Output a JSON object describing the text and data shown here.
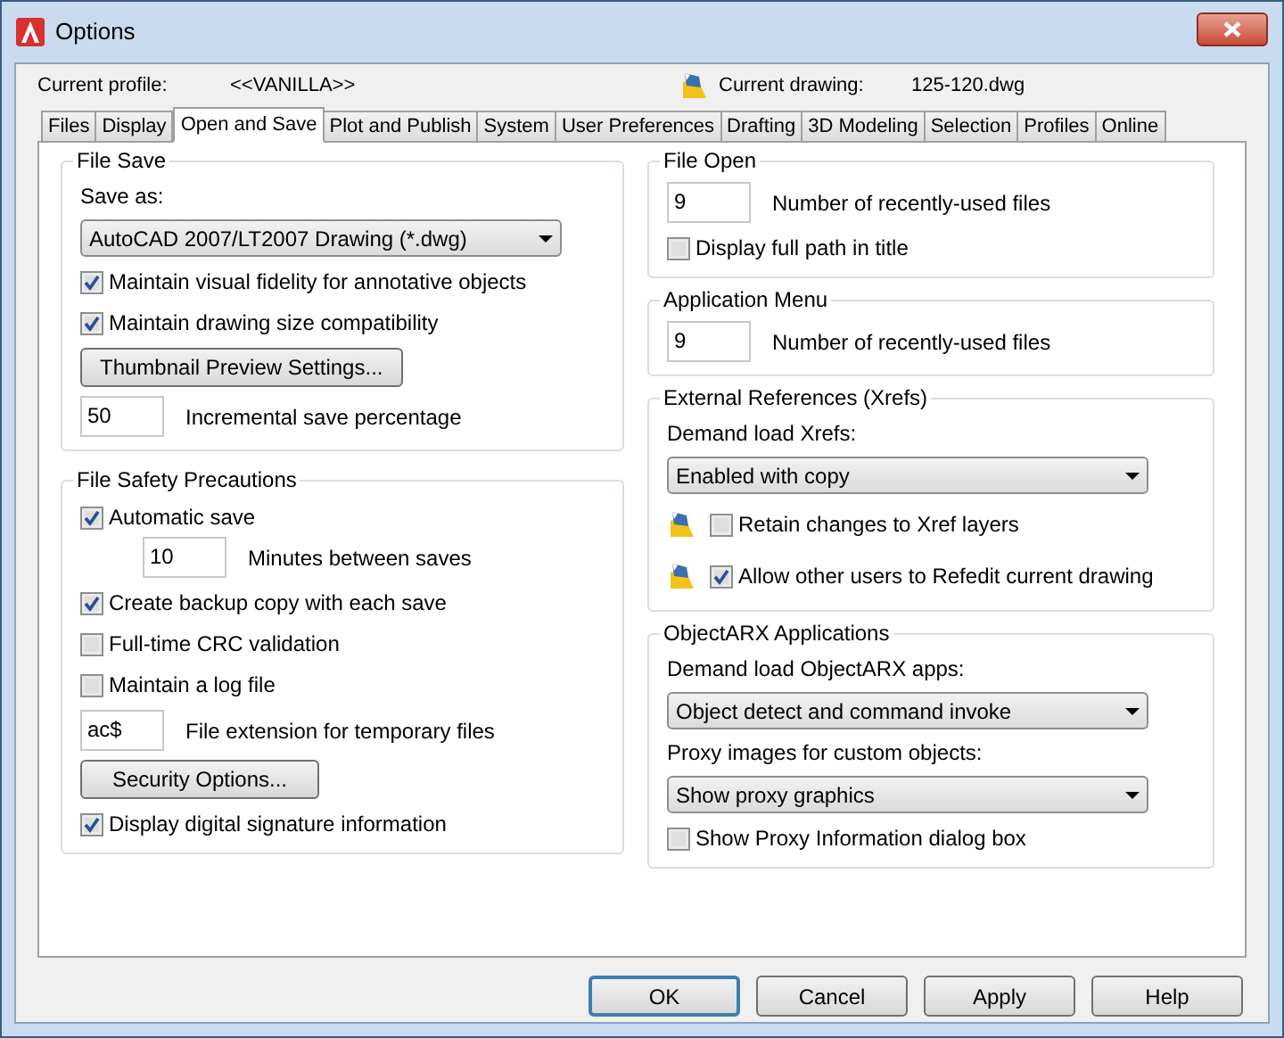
{
  "window": {
    "title": "Options"
  },
  "header": {
    "profile_label": "Current profile:",
    "profile": "<<VANILLA>>",
    "drawing_label": "Current drawing:",
    "drawing": "125-120.dwg"
  },
  "tabs": [
    {
      "label": "Files",
      "selected": false
    },
    {
      "label": "Display",
      "selected": false
    },
    {
      "label": "Open and Save",
      "selected": true
    },
    {
      "label": "Plot and Publish",
      "selected": false
    },
    {
      "label": "System",
      "selected": false
    },
    {
      "label": "User Preferences",
      "selected": false
    },
    {
      "label": "Drafting",
      "selected": false
    },
    {
      "label": "3D Modeling",
      "selected": false
    },
    {
      "label": "Selection",
      "selected": false
    },
    {
      "label": "Profiles",
      "selected": false
    },
    {
      "label": "Online",
      "selected": false
    }
  ],
  "columns": [
    [
      {
        "title": "File Save",
        "items": [
          {
            "kind": "label",
            "text": "Save as:"
          },
          {
            "kind": "dropdown",
            "value": "AutoCAD 2007/LT2007 Drawing (*.dwg)"
          },
          {
            "kind": "checkbox",
            "label": "Maintain visual fidelity for annotative objects",
            "checked": true
          },
          {
            "kind": "checkbox",
            "label": "Maintain drawing size compatibility",
            "checked": true
          },
          {
            "kind": "button",
            "label": "Thumbnail Preview Settings..."
          },
          {
            "kind": "number",
            "value": "50",
            "caption": "Incremental save percentage"
          }
        ]
      },
      {
        "title": "File Safety Precautions",
        "items": [
          {
            "kind": "checkbox",
            "label": "Automatic save",
            "checked": true,
            "children": [
              {
                "kind": "number",
                "value": "10",
                "caption": "Minutes between saves"
              }
            ]
          },
          {
            "kind": "checkbox",
            "label": "Create backup copy with each save",
            "checked": true
          },
          {
            "kind": "checkbox",
            "label": "Full-time CRC validation",
            "checked": false
          },
          {
            "kind": "checkbox",
            "label": "Maintain a log file",
            "checked": false
          },
          {
            "kind": "number",
            "value": "ac$",
            "caption": "File extension for temporary files"
          },
          {
            "kind": "button",
            "label": "Security Options..."
          },
          {
            "kind": "checkbox",
            "label": "Display digital signature information",
            "checked": true
          }
        ]
      }
    ],
    [
      {
        "title": "File Open",
        "items": [
          {
            "kind": "number",
            "value": "9",
            "caption": "Number of recently-used files"
          },
          {
            "kind": "checkbox",
            "label": "Display full path in title",
            "checked": false
          }
        ]
      },
      {
        "title": "Application Menu",
        "items": [
          {
            "kind": "number",
            "value": "9",
            "caption": "Number of recently-used files"
          }
        ]
      },
      {
        "title": "External References (Xrefs)",
        "items": [
          {
            "kind": "label",
            "text": "Demand load Xrefs:"
          },
          {
            "kind": "dropdown",
            "value": "Enabled with copy"
          },
          {
            "kind": "drawing_checkbox",
            "label": "Retain changes to Xref layers",
            "checked": false
          },
          {
            "kind": "drawing_checkbox",
            "label": "Allow other users to Refedit current drawing",
            "checked": true
          }
        ]
      },
      {
        "title": "ObjectARX Applications",
        "items": [
          {
            "kind": "label",
            "text": "Demand load ObjectARX apps:"
          },
          {
            "kind": "dropdown",
            "value": "Object detect and command invoke"
          },
          {
            "kind": "label",
            "text": "Proxy images for custom objects:"
          },
          {
            "kind": "dropdown",
            "value": "Show proxy graphics"
          },
          {
            "kind": "checkbox",
            "label": "Show Proxy Information dialog box",
            "checked": false
          }
        ]
      }
    ]
  ],
  "buttons": [
    {
      "label": "OK",
      "default": true
    },
    {
      "label": "Cancel",
      "default": false
    },
    {
      "label": "Apply",
      "default": false
    },
    {
      "label": "Help",
      "default": false
    }
  ]
}
